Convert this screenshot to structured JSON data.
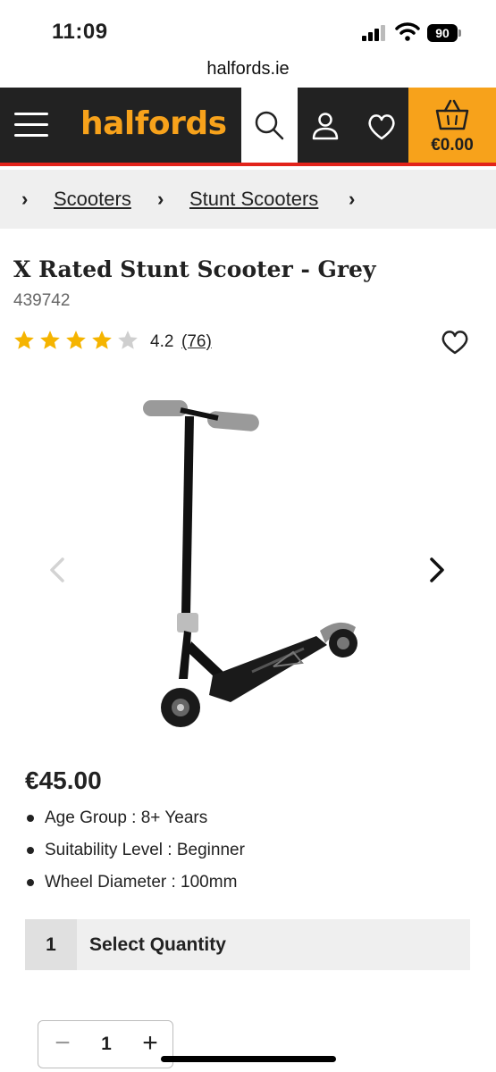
{
  "status_bar": {
    "time": "11:09",
    "battery": "90"
  },
  "browser": {
    "url": "halfords.ie"
  },
  "header": {
    "logo": "halfords",
    "basket_total": "€0.00",
    "brand_color": "#f7a21b",
    "accent_color": "#e2231a",
    "icons": [
      "menu-icon",
      "search-icon",
      "account-icon",
      "heart-icon",
      "basket-icon"
    ]
  },
  "breadcrumb": {
    "items": [
      "Scooters",
      "Stunt Scooters"
    ]
  },
  "product": {
    "title": "X Rated Stunt Scooter - Grey",
    "code": "439742",
    "rating": "4.2",
    "rating_stars": 4.2,
    "review_count": "(76)",
    "price": "€45.00",
    "features": [
      "Age Group : 8+ Years",
      "Suitability Level : Beginner",
      "Wheel Diameter : 100mm"
    ]
  },
  "quantity": {
    "select_value": "1",
    "select_label": "Select Quantity",
    "stepper_value": "1"
  }
}
